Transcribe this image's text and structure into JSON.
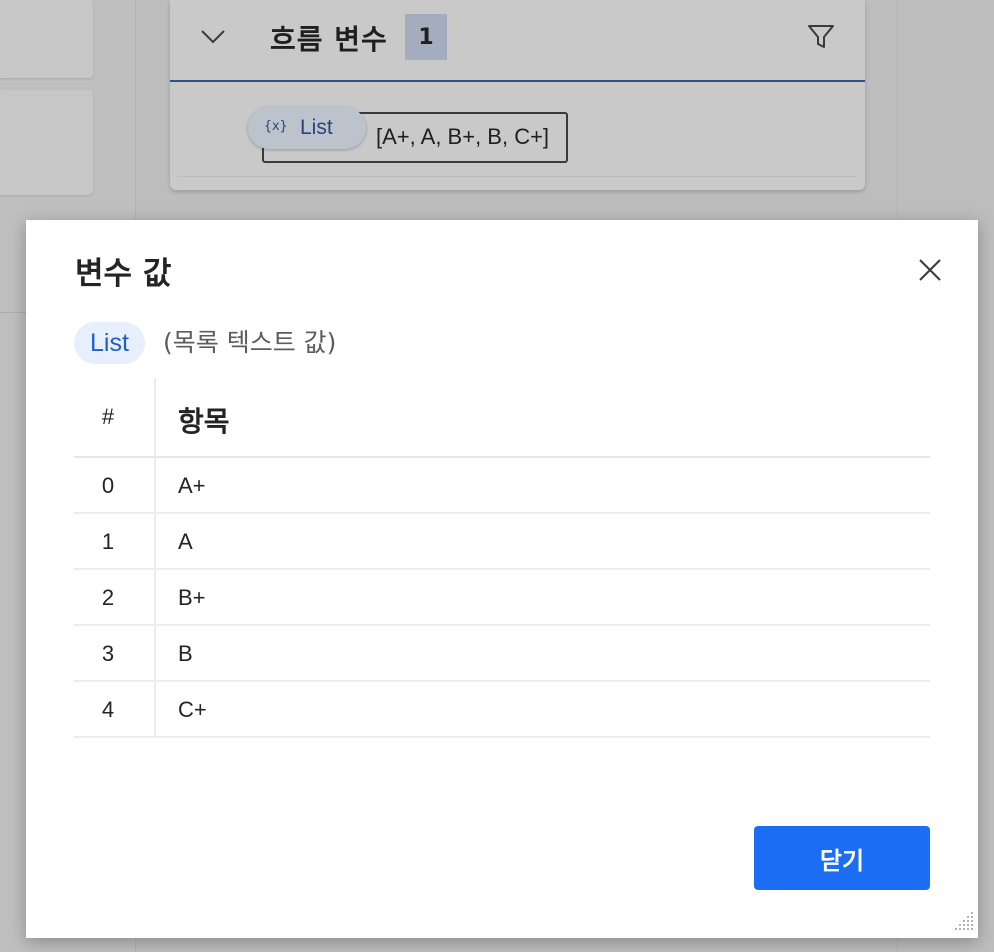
{
  "background": {
    "flow_panel": {
      "title": "흐름 변수",
      "count": "1",
      "variable": {
        "chip_icon": "{x}",
        "name": "List",
        "value": "[A+, A, B+, B, C+]"
      }
    }
  },
  "dialog": {
    "title": "변수 값",
    "type_chip": "List",
    "type_description": "(목록 텍스트 값)",
    "table": {
      "headers": [
        "#",
        "항목"
      ],
      "rows": [
        {
          "index": "0",
          "value": "A+"
        },
        {
          "index": "1",
          "value": "A"
        },
        {
          "index": "2",
          "value": "B+"
        },
        {
          "index": "3",
          "value": "B"
        },
        {
          "index": "4",
          "value": "C+"
        }
      ]
    },
    "close_button_label": "닫기"
  },
  "colors": {
    "primary": "#1b6ef3",
    "chip_background": "#e6effb",
    "chip_text": "#1f5fc4"
  },
  "icons": [
    "chevron-down-icon",
    "filter-icon",
    "close-icon",
    "resize-grip-icon"
  ]
}
